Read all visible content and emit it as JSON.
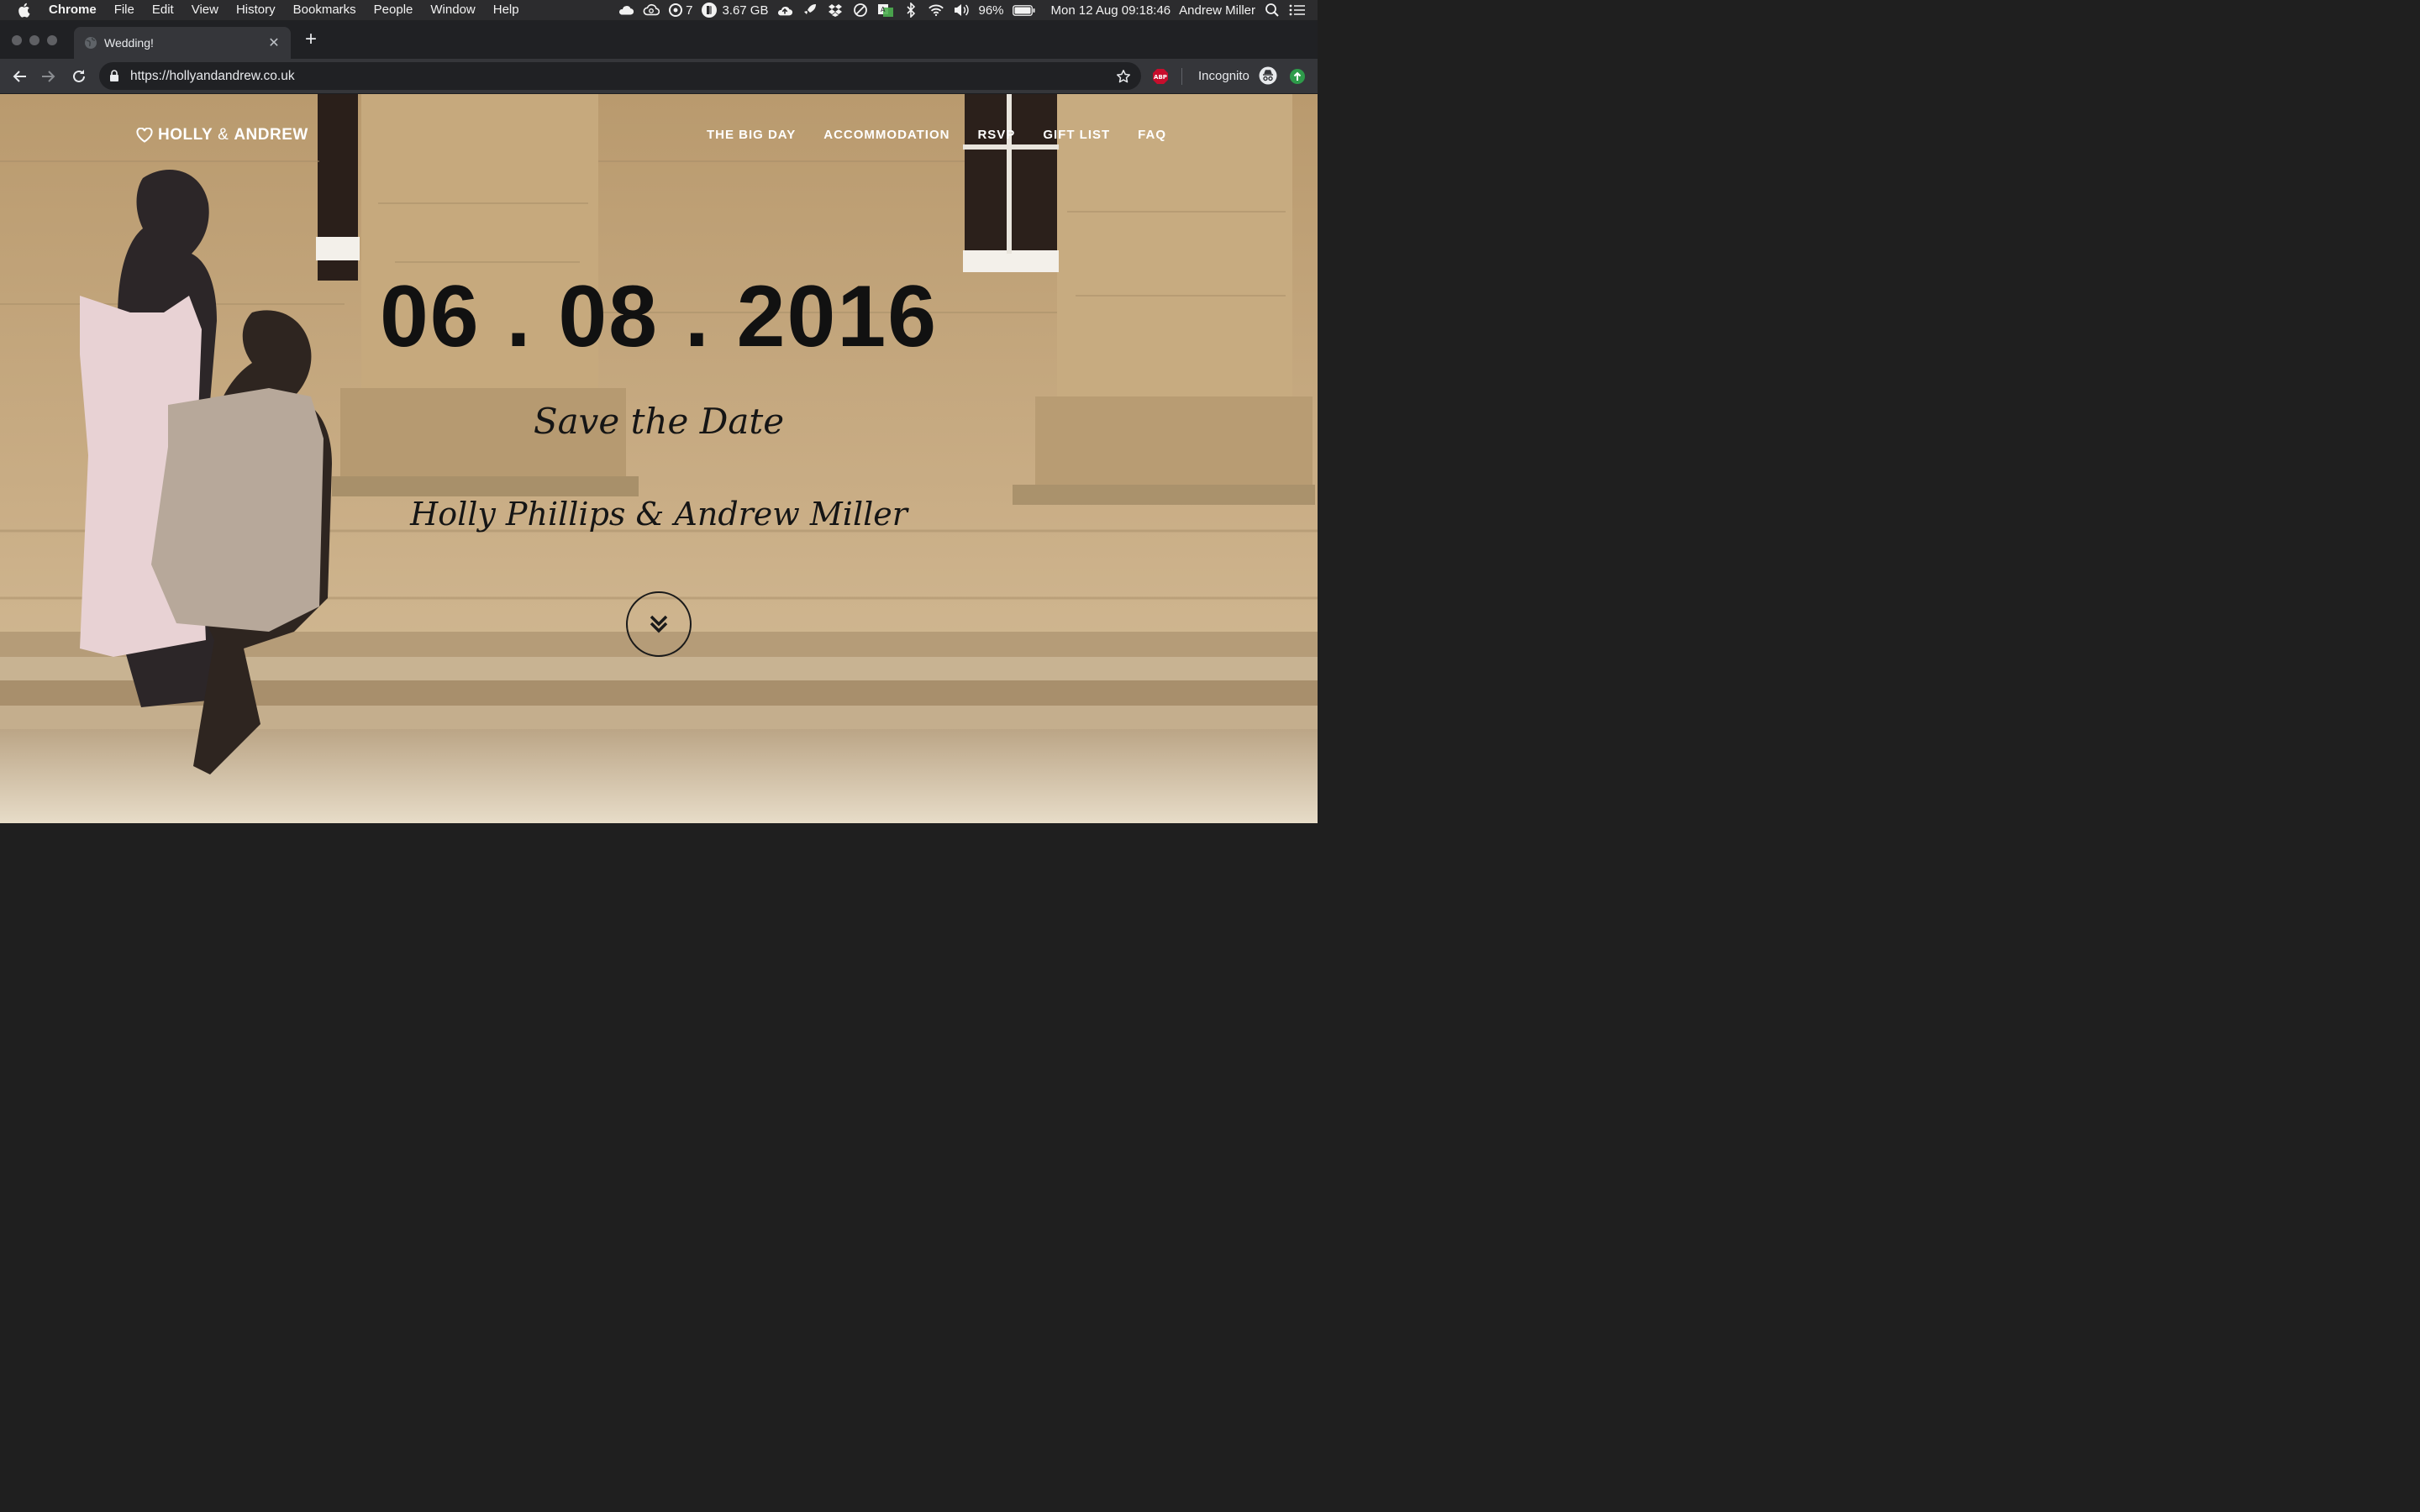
{
  "menubar": {
    "app_name": "Chrome",
    "menus": [
      "File",
      "Edit",
      "View",
      "History",
      "Bookmarks",
      "People",
      "Window",
      "Help"
    ],
    "notification_count": "7",
    "memory": "3.67 GB",
    "battery": "96%",
    "datetime": "Mon 12 Aug  09:18:46",
    "user": "Andrew Miller"
  },
  "browser": {
    "tab_title": "Wedding!",
    "url": "https://hollyandandrew.co.uk",
    "abp_label": "ABP",
    "incognito_label": "Incognito"
  },
  "site": {
    "logo_prefix": "HOLLY",
    "logo_amp": "&",
    "logo_suffix": "ANDREW",
    "nav": [
      "THE BIG DAY",
      "ACCOMMODATION",
      "RSVP",
      "GIFT LIST",
      "FAQ"
    ],
    "date": "06 . 08 . 2016",
    "tagline": "Save the Date",
    "names": "Holly Phillips & Andrew Miller"
  },
  "colors": {
    "menubar_bg": "#2c2c2e",
    "tabstrip_bg": "#202124",
    "toolbar_bg": "#35363a",
    "hero_text": "#111111",
    "nav_text": "#ffffff"
  }
}
